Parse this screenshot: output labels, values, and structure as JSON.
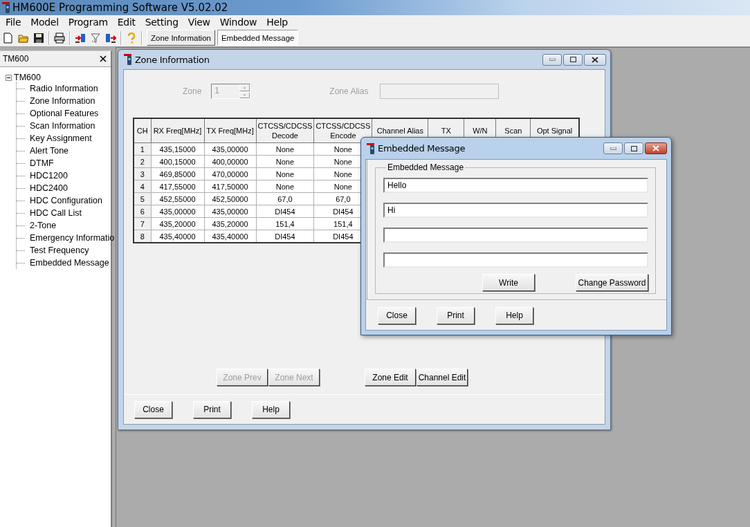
{
  "window": {
    "title": "HM600E Programming Software V5.02.02"
  },
  "menu": [
    "File",
    "Model",
    "Program",
    "Edit",
    "Setting",
    "View",
    "Window",
    "Help"
  ],
  "toolbar": {
    "tabs": [
      {
        "label": "Zone Information",
        "selected": false
      },
      {
        "label": "Embedded Message",
        "selected": true
      }
    ]
  },
  "sidebar": {
    "title": "TM600",
    "tree": [
      {
        "label": "TM600",
        "expanded": true,
        "children": [
          {
            "label": "Radio Information"
          },
          {
            "label": "Zone Information"
          },
          {
            "label": "Optional Features"
          },
          {
            "label": "Scan Information"
          },
          {
            "label": "Key Assignment"
          },
          {
            "label": "Alert Tone"
          },
          {
            "label": "DTMF"
          },
          {
            "label": "HDC1200"
          },
          {
            "label": "HDC2400"
          },
          {
            "label": "HDC Configuration"
          },
          {
            "label": "HDC Call List"
          },
          {
            "label": "2-Tone"
          },
          {
            "label": "Emergency Informatio"
          },
          {
            "label": "Test Frequency"
          },
          {
            "label": "Embedded Message"
          }
        ]
      }
    ]
  },
  "zone_window": {
    "title": "Zone Information",
    "zone": {
      "label": "Zone",
      "value": "1",
      "disabled": true
    },
    "zone_alias": {
      "label": "Zone Alias",
      "disabled": true
    },
    "table": {
      "columns": [
        "CH",
        "RX Freq[MHz]",
        "TX Freq[MHz]",
        "CTCSS/CDCSS Decode",
        "CTCSS/CDCSS Encode",
        "Channel Alias",
        "TX",
        "W/N",
        "Scan",
        "Opt Signal"
      ],
      "rows": [
        [
          "1",
          "435,15000",
          "435,00000",
          "None",
          "None"
        ],
        [
          "2",
          "400,15000",
          "400,00000",
          "None",
          "None"
        ],
        [
          "3",
          "469,85000",
          "470,00000",
          "None",
          "None"
        ],
        [
          "4",
          "417,55000",
          "417,50000",
          "None",
          "None"
        ],
        [
          "5",
          "452,55000",
          "452,50000",
          "67,0",
          "67,0"
        ],
        [
          "6",
          "435,00000",
          "435,00000",
          "DI454",
          "DI454"
        ],
        [
          "7",
          "435,20000",
          "435,20000",
          "151,4",
          "151,4"
        ],
        [
          "8",
          "435,40000",
          "435,40000",
          "DI454",
          "DI454"
        ]
      ]
    },
    "buttons": [
      {
        "label": "Zone Prev",
        "disabled": true
      },
      {
        "label": "Zone Next",
        "disabled": true
      },
      {
        "label": "Zone Edit",
        "disabled": false
      },
      {
        "label": "Channel Edit",
        "disabled": false
      }
    ],
    "footer_buttons": [
      "Close",
      "Print",
      "Help"
    ]
  },
  "message_window": {
    "title": "Embedded Message",
    "group_label": "Embedded Message",
    "fields": [
      {
        "value": "Hello"
      },
      {
        "value": "Hi"
      }
    ],
    "buttons": [
      "Write",
      "Change Password"
    ],
    "footer_buttons": [
      "Close",
      "Print",
      "Help"
    ]
  }
}
